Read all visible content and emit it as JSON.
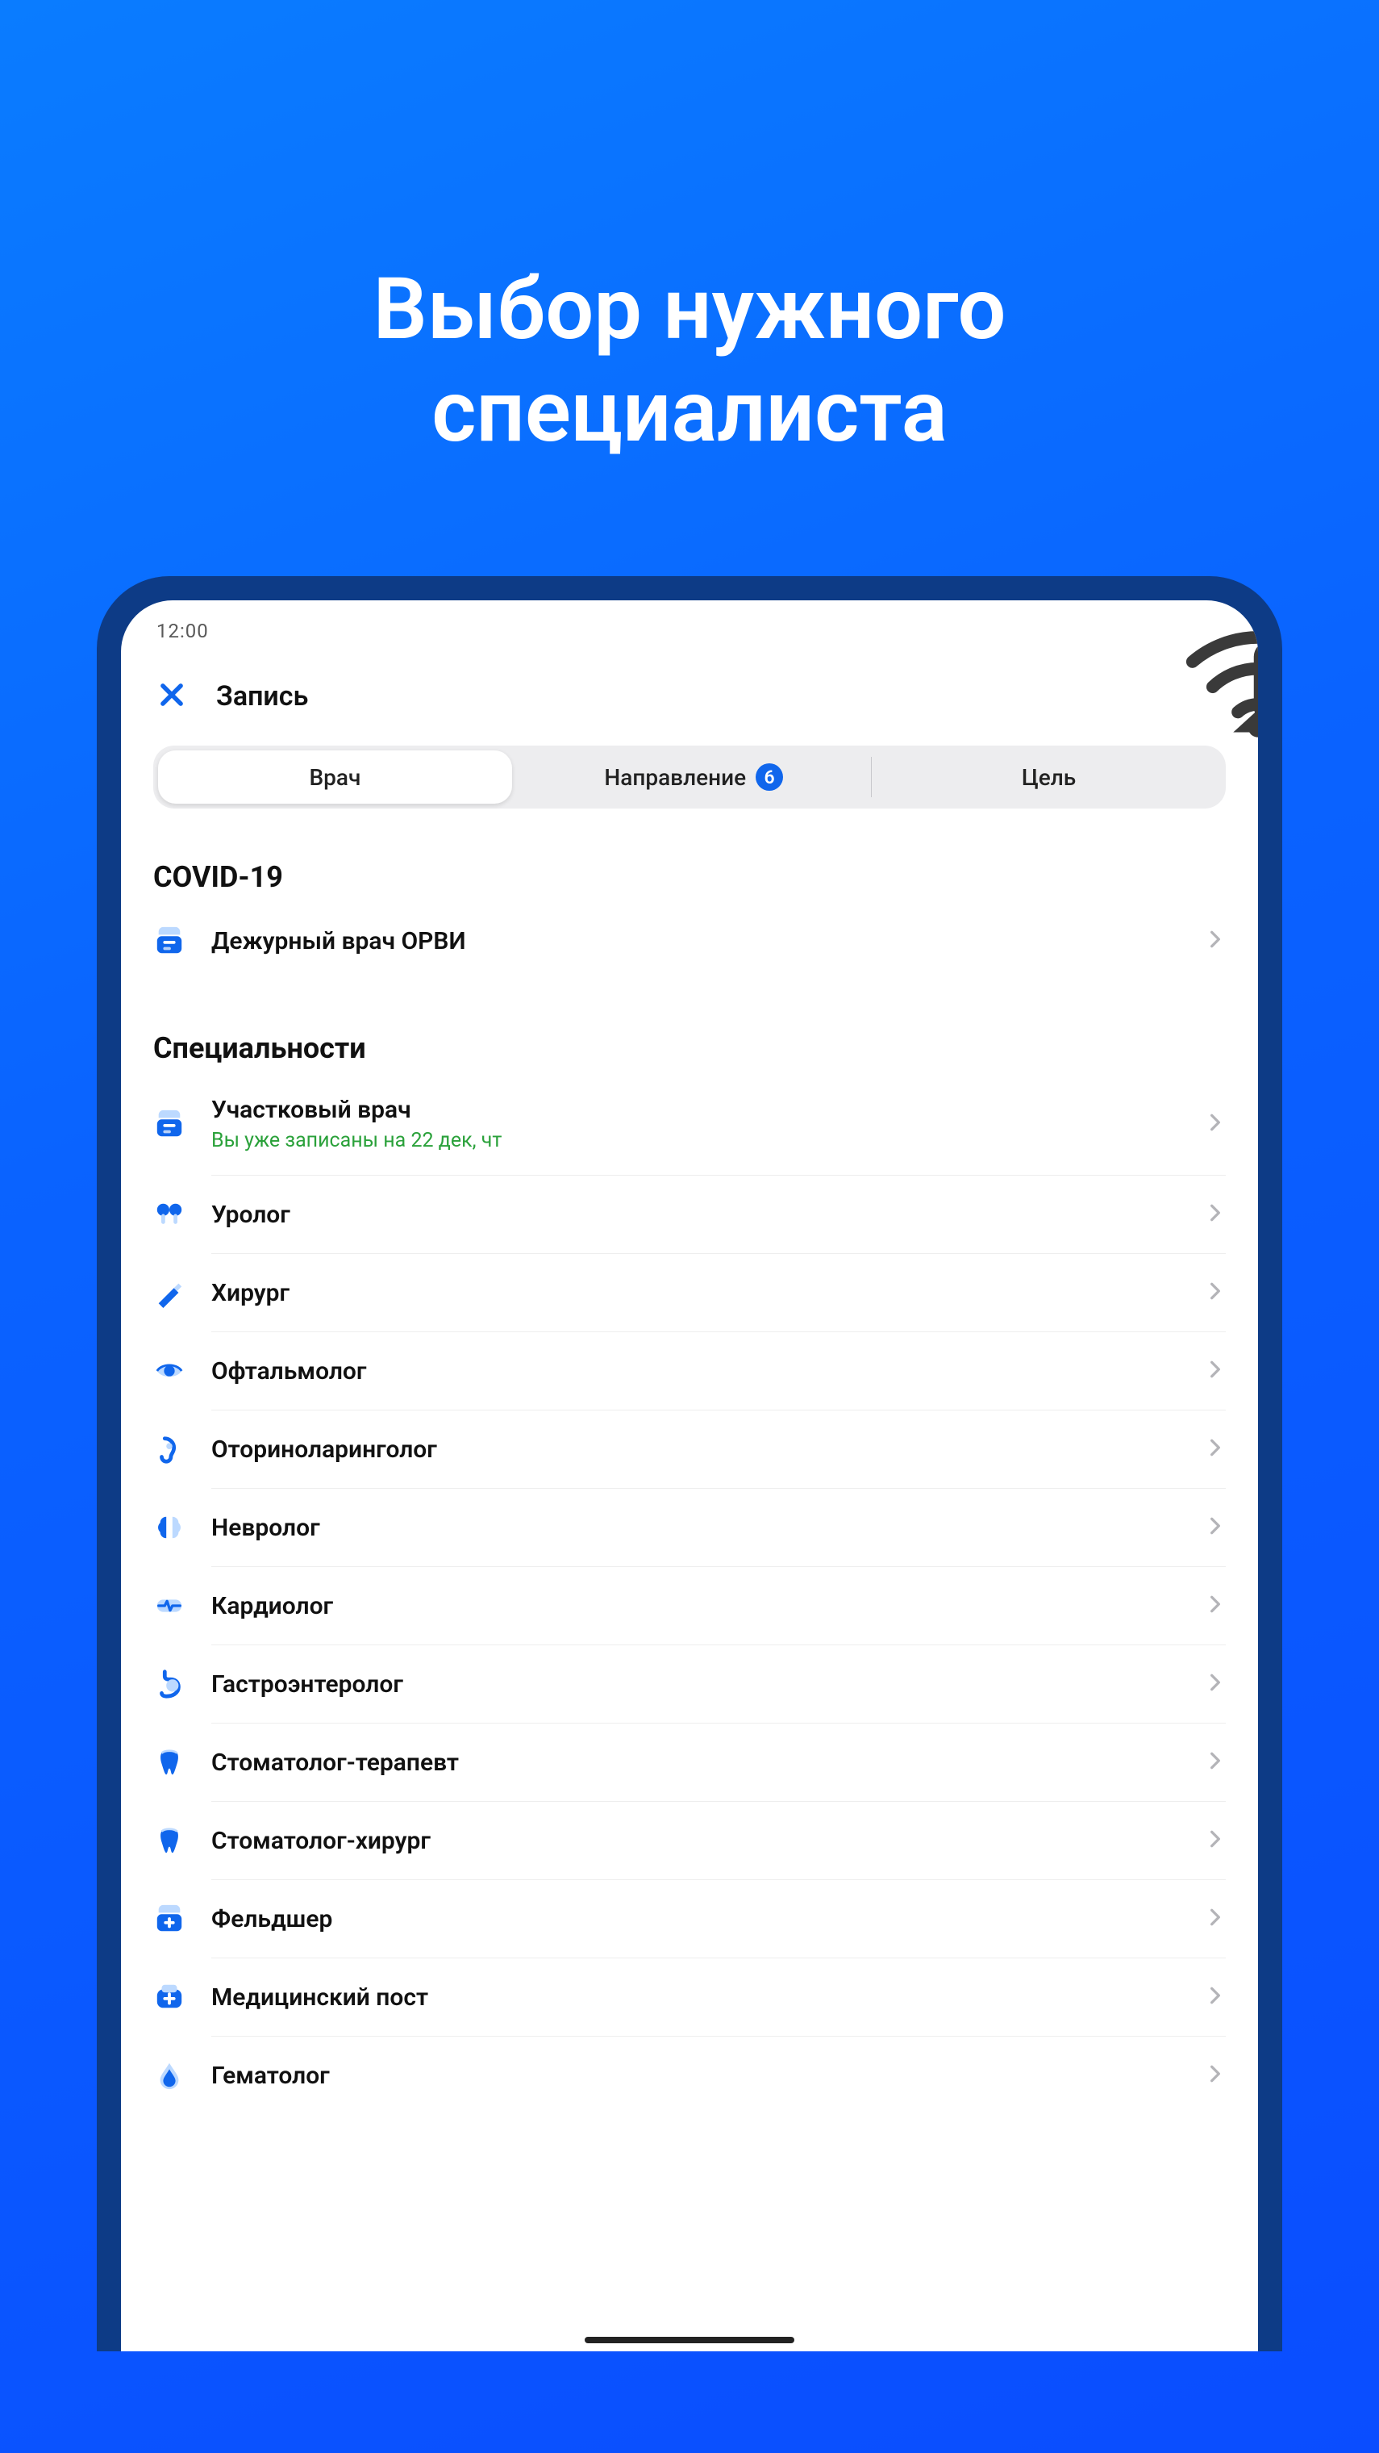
{
  "hero": {
    "line1": "Выбор нужного",
    "line2": "специалиста"
  },
  "statusbar": {
    "time": "12:00"
  },
  "header": {
    "title": "Запись"
  },
  "tabs": {
    "items": [
      {
        "label": "Врач",
        "active": true
      },
      {
        "label": "Направление",
        "badge": "6"
      },
      {
        "label": "Цель"
      }
    ]
  },
  "sections": {
    "covid": {
      "heading": "COVID-19",
      "items": [
        {
          "icon": "doctor-icon",
          "label": "Дежурный врач ОРВИ"
        }
      ]
    },
    "specialties": {
      "heading": "Специальности",
      "items": [
        {
          "icon": "doctor-icon",
          "label": "Участковый врач",
          "sub": "Вы уже записаны на 22 дек, чт"
        },
        {
          "icon": "urology-icon",
          "label": "Уролог"
        },
        {
          "icon": "scalpel-icon",
          "label": "Хирург"
        },
        {
          "icon": "eye-icon",
          "label": "Офтальмолог"
        },
        {
          "icon": "ear-icon",
          "label": "Оториноларинголог"
        },
        {
          "icon": "brain-icon",
          "label": "Невролог"
        },
        {
          "icon": "heart-icon",
          "label": "Кардиолог"
        },
        {
          "icon": "stomach-icon",
          "label": "Гастроэнтеролог"
        },
        {
          "icon": "tooth-icon",
          "label": "Стоматолог-терапевт"
        },
        {
          "icon": "tooth-icon",
          "label": "Стоматолог-хирург"
        },
        {
          "icon": "nurse-icon",
          "label": "Фельдшер"
        },
        {
          "icon": "medpost-icon",
          "label": "Медицинский пост"
        },
        {
          "icon": "blood-icon",
          "label": "Гематолог"
        }
      ]
    }
  },
  "colors": {
    "accent": "#1066ec",
    "green": "#2aa13a"
  }
}
